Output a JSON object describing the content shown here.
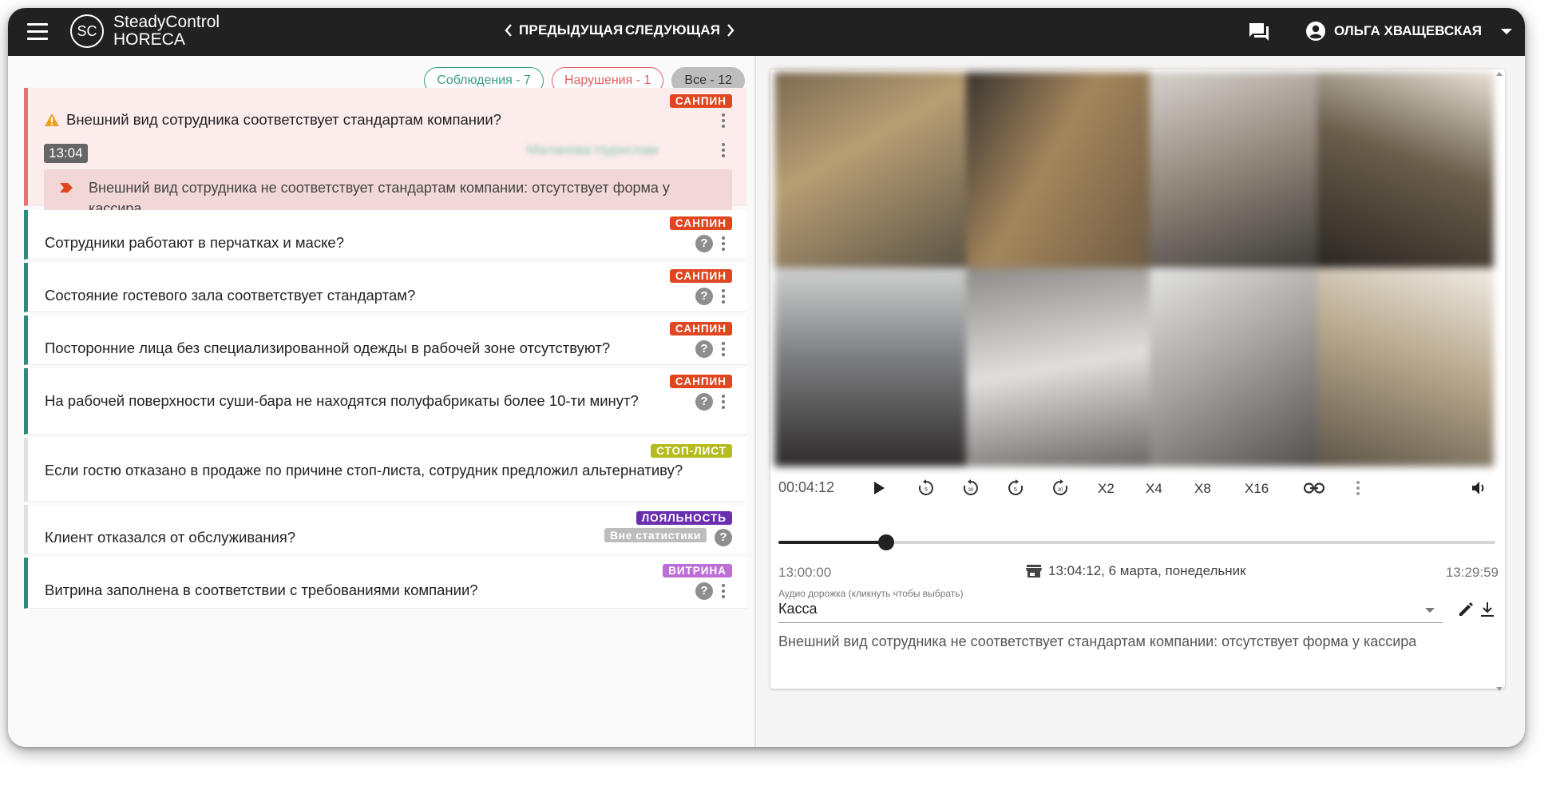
{
  "app": {
    "logo_mark": "SC",
    "title_line1": "SteadyControl",
    "title_line2": "HORECA"
  },
  "nav": {
    "prev_label": "ПРЕДЫДУЩАЯ",
    "next_label": "СЛЕДУЮЩАЯ"
  },
  "user": {
    "name": "ОЛЬГА ХВАЩЕВСКАЯ"
  },
  "filters": {
    "ok": "Соблюдения - 7",
    "bad": "Нарушения - 1",
    "all": "Все - 12"
  },
  "items": [
    {
      "question": "Внешний вид сотрудника соответствует стандартам компании?",
      "tag": "САНПИН",
      "time": "13:04",
      "user_blurred": "Маланова Нурислам",
      "note": "Внешний вид сотрудника не соответствует стандартам компании: отсутствует форма у кассира"
    },
    {
      "question": "Сотрудники работают в перчатках и маске?",
      "tag": "САНПИН"
    },
    {
      "question": "Состояние гостевого зала соответствует стандартам?",
      "tag": "САНПИН"
    },
    {
      "question": "Посторонние лица без специализированной одежды в рабочей зоне отсутствуют?",
      "tag": "САНПИН"
    },
    {
      "question": "На рабочей поверхности суши-бара не находятся полуфабрикаты более 10-ти минут?",
      "tag": "САНПИН"
    },
    {
      "question": "Если гостю отказано в продаже по причине стоп-листа, сотрудник предложил альтернативу?",
      "tag": "СТОП-ЛИСТ"
    },
    {
      "question": "Клиент отказался от обслуживания?",
      "tag": "ЛОЯЛЬНОСТЬ",
      "extra": "Вне статистики"
    },
    {
      "question": "Витрина заполнена в соответствии с требованиями компании?",
      "tag": "ВИТРИНА"
    }
  ],
  "colors": {
    "sanpin": "#e0461f",
    "stoplist": "#b5bd1e",
    "loyalty": "#6a2fb0",
    "vitrina": "#bd6fd6",
    "ok_border": "#2e8a7c",
    "bad_border": "#e57373"
  },
  "player": {
    "current_time": "00:04:12",
    "speeds": [
      "X2",
      "X4",
      "X8",
      "X16"
    ],
    "progress": 0.15,
    "range_start": "13:00:00",
    "range_end": "13:29:59",
    "date": "13:04:12, 6 марта, понедельник",
    "audio_hint": "Аудио дорожка (кликнуть чтобы выбрать)",
    "audio_value": "Касса",
    "comment": "Внешний вид сотрудника не соответствует стандартам компании: отсутствует форма у кассира"
  }
}
